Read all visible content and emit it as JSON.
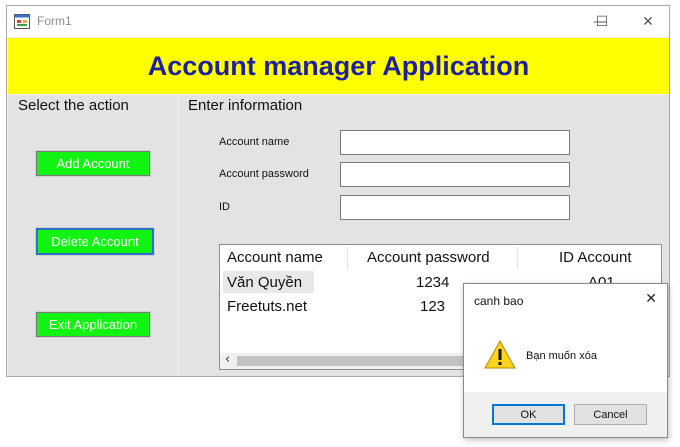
{
  "window": {
    "title": "Form1",
    "minimize_glyph": "—",
    "maximize_glyph": "☐",
    "close_glyph": "✕"
  },
  "header": {
    "title": "Account manager Application"
  },
  "actions": {
    "group_title": "Select the action",
    "add_label": "Add Account",
    "delete_label": "Delete Account",
    "exit_label": "Exit Application"
  },
  "form": {
    "group_title": "Enter information",
    "fields": [
      {
        "label": "Account name",
        "value": ""
      },
      {
        "label": "Account password",
        "value": ""
      },
      {
        "label": "ID",
        "value": ""
      }
    ]
  },
  "list": {
    "columns": [
      "Account name",
      "Account password",
      "ID Account"
    ],
    "rows": [
      [
        "Văn Quyền",
        "1234",
        "A01"
      ],
      [
        "Freetuts.net",
        "123",
        ""
      ]
    ],
    "scroll_left_glyph": "‹"
  },
  "dialog": {
    "title": "canh bao",
    "close_glyph": "✕",
    "message": "Bạn muốn xóa",
    "ok_label": "OK",
    "cancel_label": "Cancel",
    "icon": "warning-icon"
  },
  "colors": {
    "header_bg": "#ffff00",
    "header_text": "#1f1fa0",
    "button_bg": "#11f311",
    "focus_border": "#2a72c8"
  }
}
